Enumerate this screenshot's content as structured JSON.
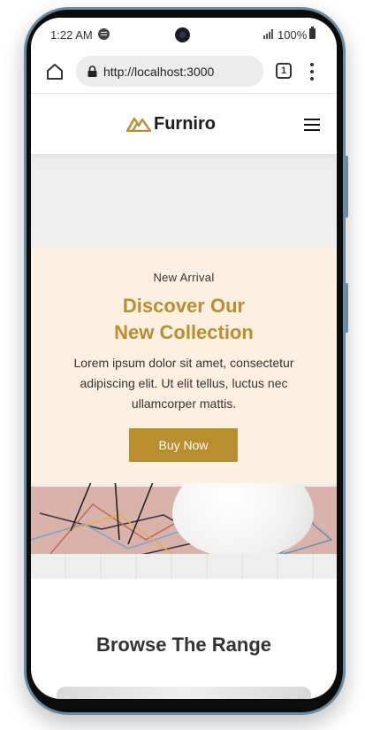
{
  "status_bar": {
    "time": "1:22 AM",
    "battery": "100%"
  },
  "browser": {
    "url": "http://localhost:3000",
    "tab_count": "1"
  },
  "site": {
    "brand": "Furniro",
    "brand_color": "#b88e2f"
  },
  "hero": {
    "eyebrow": "New Arrival",
    "title_line1": "Discover Our",
    "title_line2": "New Collection",
    "description": "Lorem ipsum dolor sit amet, consectetur adipiscing elit. Ut elit tellus, luctus nec ullamcorper mattis.",
    "button_label": "Buy Now",
    "card_color": "#fdf0e1"
  },
  "browse": {
    "title": "Browse The Range"
  }
}
